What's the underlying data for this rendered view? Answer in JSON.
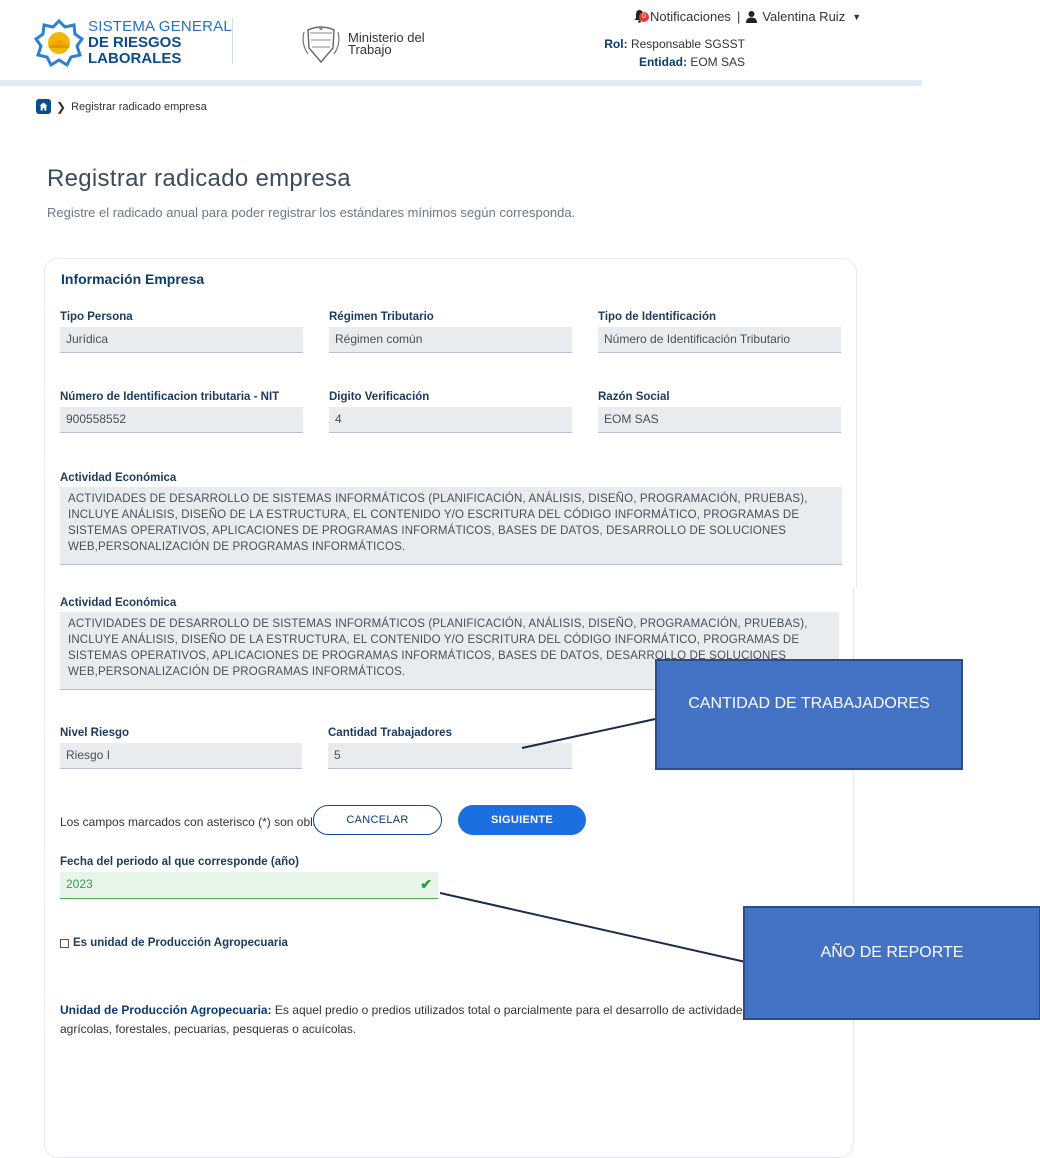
{
  "header": {
    "logo_line1": "SISTEMA GENERAL",
    "logo_line2": "DE RIESGOS",
    "logo_line3": "LABORALES",
    "ministry_line1": "Ministerio del",
    "ministry_line2": "Trabajo",
    "notif_count": "0",
    "notifications_label": "Notificaciones",
    "separator": "|",
    "user_name": "Valentina Ruiz",
    "role_label": "Rol:",
    "role_value": "Responsable SGSST",
    "entity_label": "Entidad:",
    "entity_value": "EOM SAS"
  },
  "breadcrumb": {
    "current": "Registrar radicado empresa"
  },
  "page": {
    "title": "Registrar radicado empresa",
    "subtitle": "Registre el radicado anual para poder registrar los estándares mínimos según corresponda."
  },
  "company": {
    "section_title": "Información Empresa",
    "tipo_persona_label": "Tipo Persona",
    "tipo_persona_value": "Jurídica",
    "regimen_label": "Régimen Tributario",
    "regimen_value": "Régimen común",
    "tipo_id_label": "Tipo de Identificación",
    "tipo_id_value": "Número de Identificación Tributario",
    "nit_label": "Número de Identificacion tributaria - NIT",
    "nit_value": "900558552",
    "digito_label": "Digito Verificación",
    "digito_value": "4",
    "razon_label": "Razón Social",
    "razon_value": "EOM SAS",
    "actividad_label": "Actividad Económica",
    "actividad_value": "ACTIVIDADES DE DESARROLLO DE SISTEMAS INFORMÁTICOS (PLANIFICACIÓN, ANÁLISIS, DISEÑO, PROGRAMACIÓN, PRUEBAS), INCLUYE ANÁLISIS, DISEÑO DE LA ESTRUCTURA, EL CONTENIDO Y/O ESCRITURA DEL CÓDIGO INFORMÁTICO, PROGRAMAS DE SISTEMAS OPERATIVOS, APLICACIONES DE PROGRAMAS INFORMÁTICOS, BASES DE DATOS, DESARROLLO DE SOLUCIONES WEB,PERSONALIZACIÓN DE PROGRAMAS INFORMÁTICOS.",
    "nivel_riesgo_label": "Nivel Riesgo",
    "nivel_riesgo_value": "Riesgo I",
    "cantidad_label": "Cantidad Trabajadores",
    "cantidad_value": "5"
  },
  "form": {
    "required_note": "Los campos marcados con asterisco (*) son obligatorios",
    "fecha_label": "Fecha del periodo al que corresponde (año)",
    "fecha_value": "2023",
    "checkbox_label": "Es unidad de Producción Agropecuaria",
    "upa_term": "Unidad de Producción Agropecuaria:",
    "upa_desc": " Es aquel predio o predios utilizados total o parcialmente para el desarrollo de actividades agrícolas, forestales, pecuarias, pesqueras o acuícolas.",
    "cancel_label": "CANCELAR",
    "next_label": "SIGUIENTE"
  },
  "annotations": {
    "callout1": "CANTIDAD DE TRABAJADORES",
    "callout2": "AÑO DE REPORTE",
    "callout_color": "#4472c4"
  }
}
